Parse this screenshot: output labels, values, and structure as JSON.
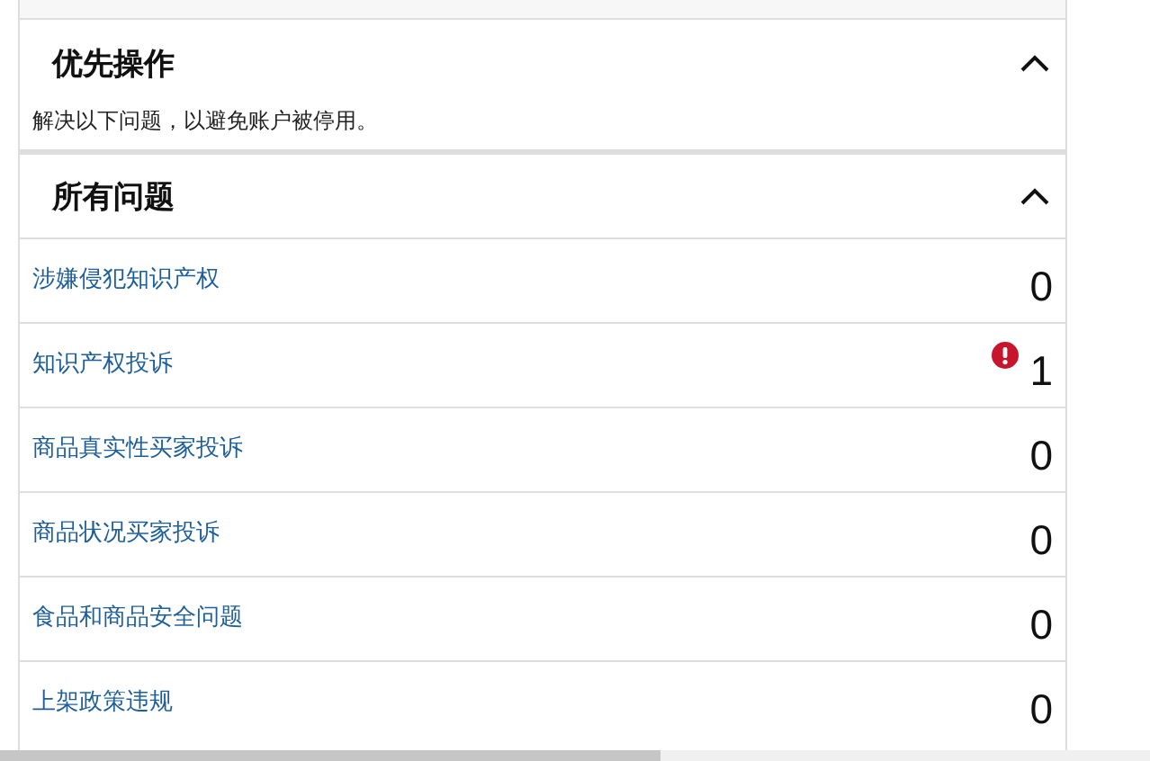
{
  "sections": [
    {
      "title": "优先操作",
      "expanded": true,
      "description": "解决以下问题，以避免账户被停用。"
    },
    {
      "title": "所有问题",
      "expanded": true,
      "rows": [
        {
          "label": "涉嫌侵犯知识产权",
          "count": "0",
          "warning": false
        },
        {
          "label": "知识产权投诉",
          "count": "1",
          "warning": true
        },
        {
          "label": "商品真实性买家投诉",
          "count": "0",
          "warning": false
        },
        {
          "label": "商品状况买家投诉",
          "count": "0",
          "warning": false
        },
        {
          "label": "食品和商品安全问题",
          "count": "0",
          "warning": false
        },
        {
          "label": "上架政策违规",
          "count": "0",
          "warning": false
        }
      ]
    }
  ]
}
